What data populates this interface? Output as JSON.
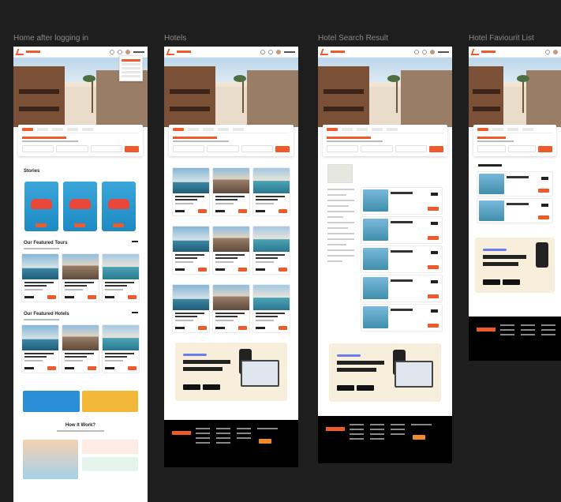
{
  "frames": [
    {
      "id": "home",
      "title": "Home after logging in"
    },
    {
      "id": "hotels",
      "title": "Hotels"
    },
    {
      "id": "search",
      "title": "Hotel Search Result"
    },
    {
      "id": "fav",
      "title": "Hotel Faviourit List"
    }
  ],
  "home": {
    "stories_title": "Stories",
    "tours_title": "Our Featured Tours",
    "hotels_title": "Our Featured Hotels",
    "how_title": "How It Work?"
  },
  "colors": {
    "accent": "#ef5a2a",
    "canvas": "#1e1e1e",
    "footer": "#000000"
  }
}
